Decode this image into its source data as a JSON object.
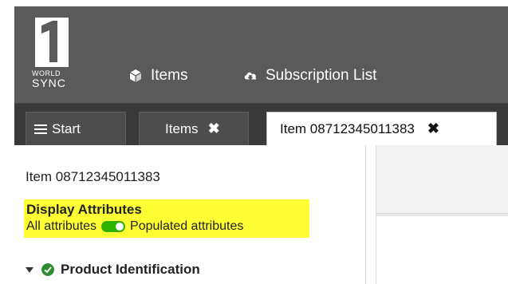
{
  "brand": {
    "logo_word": "WORLD",
    "logo_word2": "SYNC"
  },
  "topnav": {
    "items_label": "Items",
    "subscription_label": "Subscription List"
  },
  "tabs": [
    {
      "label": "Start",
      "closable": false,
      "active": false
    },
    {
      "label": "Items",
      "closable": true,
      "active": false
    },
    {
      "label": "Item 08712345011383",
      "closable": true,
      "active": true
    }
  ],
  "panel": {
    "item_title": "Item 08712345011383",
    "display_heading": "Display Attributes",
    "all_label": "All attributes",
    "populated_label": "Populated attributes",
    "toggle_on": true,
    "section_label": "Product Identification"
  },
  "icons": {
    "items": "cube-icon",
    "subscription": "cloud-download-icon",
    "start": "hamburger-icon",
    "close": "close-icon",
    "section_caret": "caret-down-icon",
    "section_status": "check-circle-icon"
  },
  "colors": {
    "header_bg": "#5a5a5a",
    "tabstrip_bg": "#393939",
    "highlight": "#ffff33",
    "toggle_on": "#2db200",
    "check_green": "#2e8b2e"
  }
}
